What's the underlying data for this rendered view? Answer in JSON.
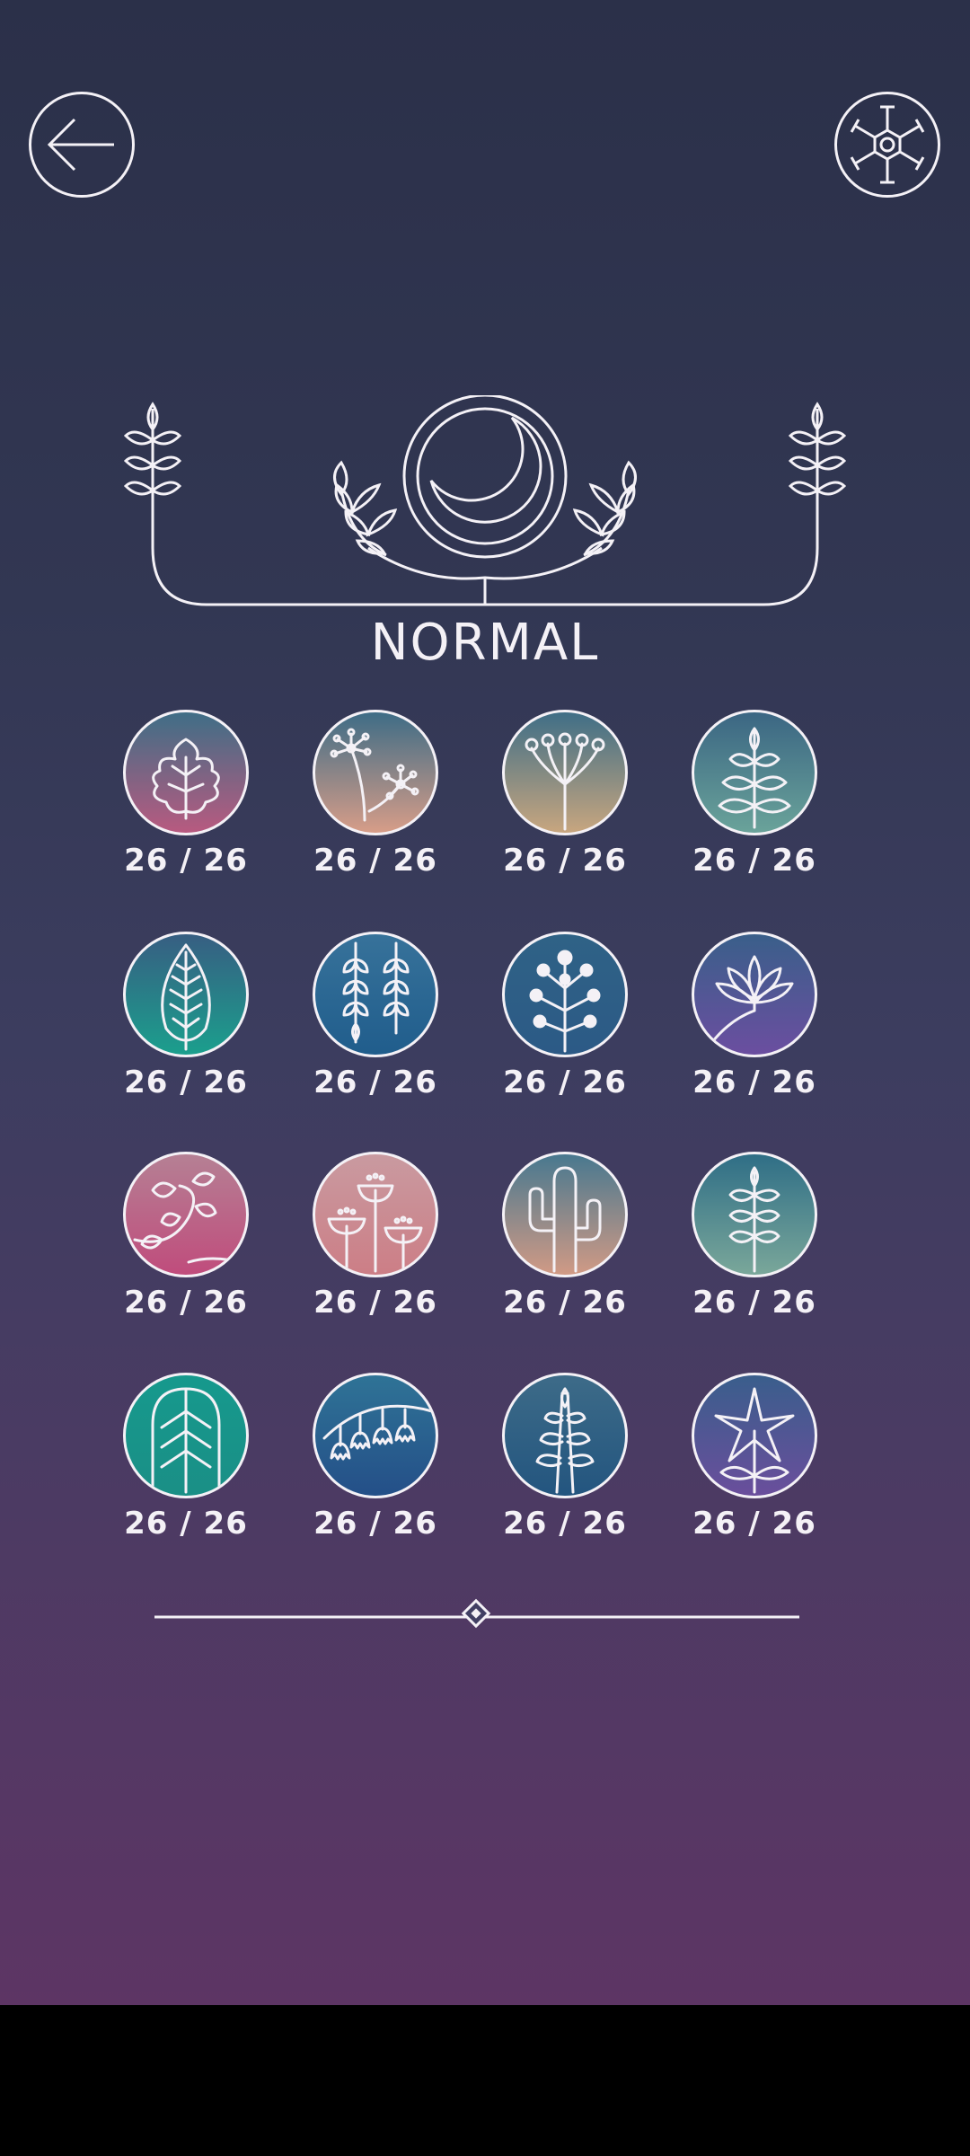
{
  "top_bar": {
    "back_icon": "arrow-left-icon",
    "settings_icon": "hexagon-gear-icon"
  },
  "mode": {
    "emblem_icon": "crescent-moon-laurel-icon",
    "title": "NORMAL"
  },
  "levels": [
    {
      "icon": "oak-leaf-icon",
      "colors": [
        "#3f6e86",
        "#b85a80"
      ],
      "count": "26 / 26"
    },
    {
      "icon": "dandelion-icon",
      "colors": [
        "#3e6c86",
        "#d79d88"
      ],
      "count": "26 / 26"
    },
    {
      "icon": "umbel-flower-icon",
      "colors": [
        "#3f6e86",
        "#c8a67f"
      ],
      "count": "26 / 26"
    },
    {
      "icon": "leafy-branch-icon",
      "colors": [
        "#3b6683",
        "#6aa39a"
      ],
      "count": "26 / 26"
    },
    {
      "icon": "fern-leaf-icon",
      "colors": [
        "#375e82",
        "#1b9f8d"
      ],
      "count": "26 / 26"
    },
    {
      "icon": "wisteria-icon",
      "colors": [
        "#37729a",
        "#205d8c"
      ],
      "count": "26 / 26"
    },
    {
      "icon": "berry-branch-icon",
      "colors": [
        "#2f6286",
        "#2c5a86"
      ],
      "count": "26 / 26"
    },
    {
      "icon": "lotus-icon",
      "colors": [
        "#3a5f8a",
        "#6b4ea0"
      ],
      "count": "26 / 26"
    },
    {
      "icon": "ivy-vine-icon",
      "colors": [
        "#b58094",
        "#c04c7c"
      ],
      "count": "26 / 26"
    },
    {
      "icon": "bell-flowers-icon",
      "colors": [
        "#c99aa0",
        "#cc7e86"
      ],
      "count": "26 / 26"
    },
    {
      "icon": "cactus-icon",
      "colors": [
        "#48788f",
        "#d19a85"
      ],
      "count": "26 / 26"
    },
    {
      "icon": "wheat-stalk-icon",
      "colors": [
        "#2f6e86",
        "#7aa79a"
      ],
      "count": "26 / 26"
    },
    {
      "icon": "leaf-veins-icon",
      "colors": [
        "#16998d",
        "#1a8f86"
      ],
      "count": "26 / 26"
    },
    {
      "icon": "lily-of-the-valley-icon",
      "colors": [
        "#2f7396",
        "#244f88"
      ],
      "count": "26 / 26"
    },
    {
      "icon": "tree-branch-icon",
      "colors": [
        "#3d6b88",
        "#23557f"
      ],
      "count": "26 / 26"
    },
    {
      "icon": "star-flower-icon",
      "colors": [
        "#3a5e8c",
        "#6a4e9c"
      ],
      "count": "26 / 26"
    }
  ],
  "divider_icon": "diamond-divider-icon"
}
